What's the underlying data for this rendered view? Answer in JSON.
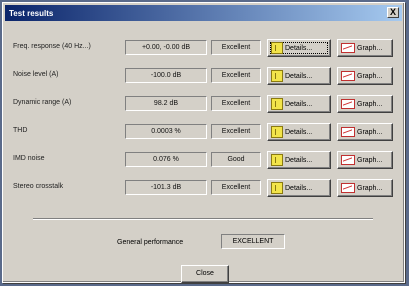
{
  "window": {
    "title": "Test results",
    "close_glyph": "X"
  },
  "rows": [
    {
      "label": "Freq. response (40 Hz...)",
      "value": "+0.00, -0.00 dB",
      "rating": "Excellent"
    },
    {
      "label": "Noise level (A)",
      "value": "-100.0 dB",
      "rating": "Excellent"
    },
    {
      "label": "Dynamic range (A)",
      "value": "98.2 dB",
      "rating": "Excellent"
    },
    {
      "label": "THD",
      "value": "0.0003 %",
      "rating": "Excellent"
    },
    {
      "label": "IMD noise",
      "value": "0.076 %",
      "rating": "Good"
    },
    {
      "label": "Stereo crosstalk",
      "value": "-101.3 dB",
      "rating": "Excellent"
    }
  ],
  "buttons": {
    "details_label": "Details...",
    "graph_label": "Graph...",
    "close_label": "Close"
  },
  "general": {
    "label": "General performance",
    "value": "EXCELLENT"
  },
  "icons": {
    "details": "details-icon",
    "graph": "graph-icon"
  }
}
